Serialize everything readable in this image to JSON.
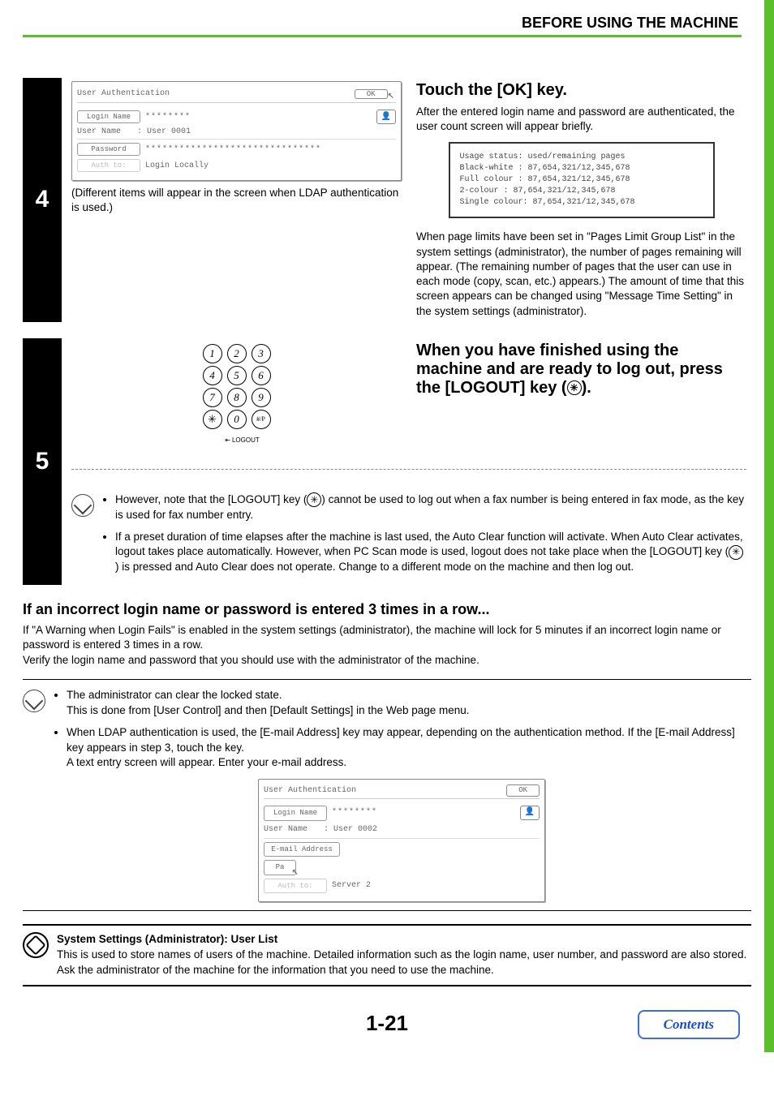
{
  "header": {
    "title": "BEFORE USING THE MACHINE"
  },
  "step4": {
    "number": "4",
    "panel": {
      "title": "User Authentication",
      "ok": "OK",
      "loginNameBtn": "Login Name",
      "loginNameVal": "********",
      "userNameLabel": "User Name",
      "userNameVal": ": User 0001",
      "passwordBtn": "Password",
      "passwordVal": "*******************************",
      "authBtn": "Auth to:",
      "authVal": "Login Locally"
    },
    "caption": "(Different items will appear in the screen when LDAP authentication is used.)",
    "title": "Touch the [OK] key.",
    "body1": "After the entered login name and password are authenticated, the user count screen will appear briefly.",
    "usage": {
      "l1": "Usage status: used/remaining pages",
      "l2": "Black-white : 87,654,321/12,345,678",
      "l3": "Full colour : 87,654,321/12,345,678",
      "l4": "2-colour    : 87,654,321/12,345,678",
      "l5": "Single colour: 87,654,321/12,345,678"
    },
    "body2": "When page limits have been set in \"Pages Limit Group List\" in the system settings (administrator), the number of pages remaining will appear. (The remaining number of pages that the user can use in each mode (copy, scan, etc.) appears.) The amount of time that this screen appears can be changed using \"Message Time Setting\" in the system settings (administrator)."
  },
  "step5": {
    "number": "5",
    "title_prefix": "When you have finished using the machine and are ready to log out, press the [LOGOUT] key (",
    "title_suffix": ").",
    "keypad": {
      "keys": [
        "1",
        "2",
        "3",
        "4",
        "5",
        "6",
        "7",
        "8",
        "9"
      ],
      "star": "✳",
      "zero": "0",
      "hash": "#/P",
      "logout": "LOGOUT"
    },
    "bullet1_a": "However, note that the [LOGOUT] key (",
    "bullet1_b": ") cannot be used to log out when a fax number is being entered in fax mode, as the key is used for fax number entry.",
    "bullet2_a": "If a preset duration of time elapses after the machine is last used, the Auto Clear function will activate. When Auto Clear activates, logout takes place automatically. However, when PC Scan mode is used, logout does not take place when the [LOGOUT] key (",
    "bullet2_b": ") is pressed and Auto Clear does not operate. Change to a different mode on the machine and then log out."
  },
  "section": {
    "title": "If an incorrect login name or password is entered 3 times in a row...",
    "p1": "If \"A Warning when Login Fails\" is enabled in the system settings (administrator), the machine will lock for 5 minutes if an incorrect login name or password is entered 3 times in a row.",
    "p2": "Verify the login name and password that you should use with the administrator of the machine."
  },
  "notes": {
    "b1a": "The administrator can clear the locked state.",
    "b1b": "This is done from [User Control] and then [Default Settings] in the Web page menu.",
    "b2a": "When LDAP authentication is used, the [E-mail Address] key may appear, depending on the authentication method. If the [E-mail Address] key appears in step 3, touch the key.",
    "b2b": "A text entry screen will appear. Enter your e-mail address."
  },
  "panel2": {
    "title": "User Authentication",
    "ok": "OK",
    "loginNameBtn": "Login Name",
    "loginNameVal": "********",
    "userNameLabel": "User Name",
    "userNameVal": ": User 0002",
    "emailBtn": "E-mail Address",
    "paBtn": "Pa",
    "authBtn": "Auth to:",
    "authVal": "Server 2"
  },
  "admin": {
    "title": "System Settings (Administrator): User List",
    "body": "This is used to store names of users of the machine. Detailed information such as the login name, user number, and password are also stored. Ask the administrator of the machine for the information that you need to use the machine."
  },
  "footer": {
    "page": "1-21",
    "contents": "Contents"
  }
}
